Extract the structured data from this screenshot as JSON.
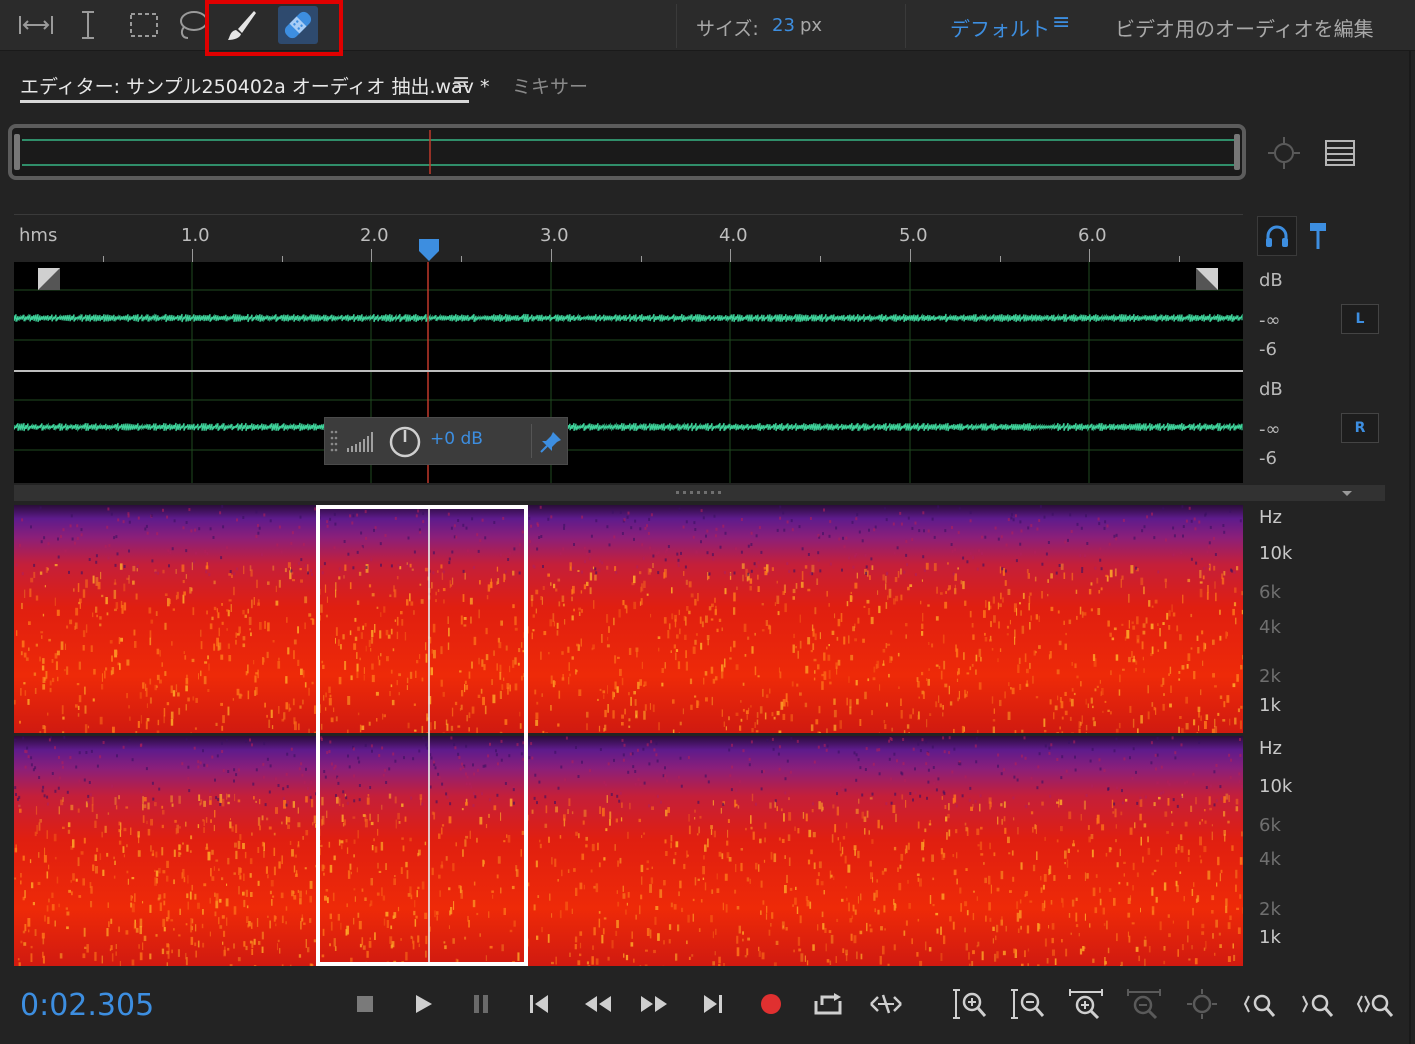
{
  "toolbar": {
    "tools": [
      "time-selection-tool",
      "time-selection-text-cursor-tool",
      "marquee-selection-tool",
      "lasso-selection-tool",
      "paintbrush-selection-tool",
      "spot-healing-brush-tool"
    ],
    "active_tool": "spot-healing-brush-tool",
    "size_label": "サイズ:",
    "size_value": "23",
    "size_unit": "px",
    "workspace_default": "デフォルト",
    "workspace_menu": "≡",
    "workspace_video": "ビデオ用のオーディオを編集"
  },
  "tabs": {
    "editor_label": "エディター: サンプル250402a オーディオ 抽出.wav *",
    "editor_menu": "≡",
    "mixer_label": "ミキサー"
  },
  "ruler": {
    "unit": "hms",
    "labels": [
      "1.0",
      "2.0",
      "3.0",
      "4.0",
      "5.0",
      "6.0"
    ]
  },
  "waveform": {
    "db_top": "dB",
    "neg_inf": "-∞",
    "minus_six": "-6",
    "left_channel": "L",
    "right_channel": "R",
    "waveform_color": "#3fd39b"
  },
  "hud": {
    "volume_value": "+0 dB"
  },
  "spectrogram": {
    "unit": "Hz",
    "labels": [
      "10k",
      "6k",
      "4k",
      "2k",
      "1k"
    ]
  },
  "transport": {
    "timecode": "0:02.305",
    "record_color": "#e03030"
  },
  "colors": {
    "accent": "#3d8ee0",
    "highlight_red": "#e00000"
  }
}
